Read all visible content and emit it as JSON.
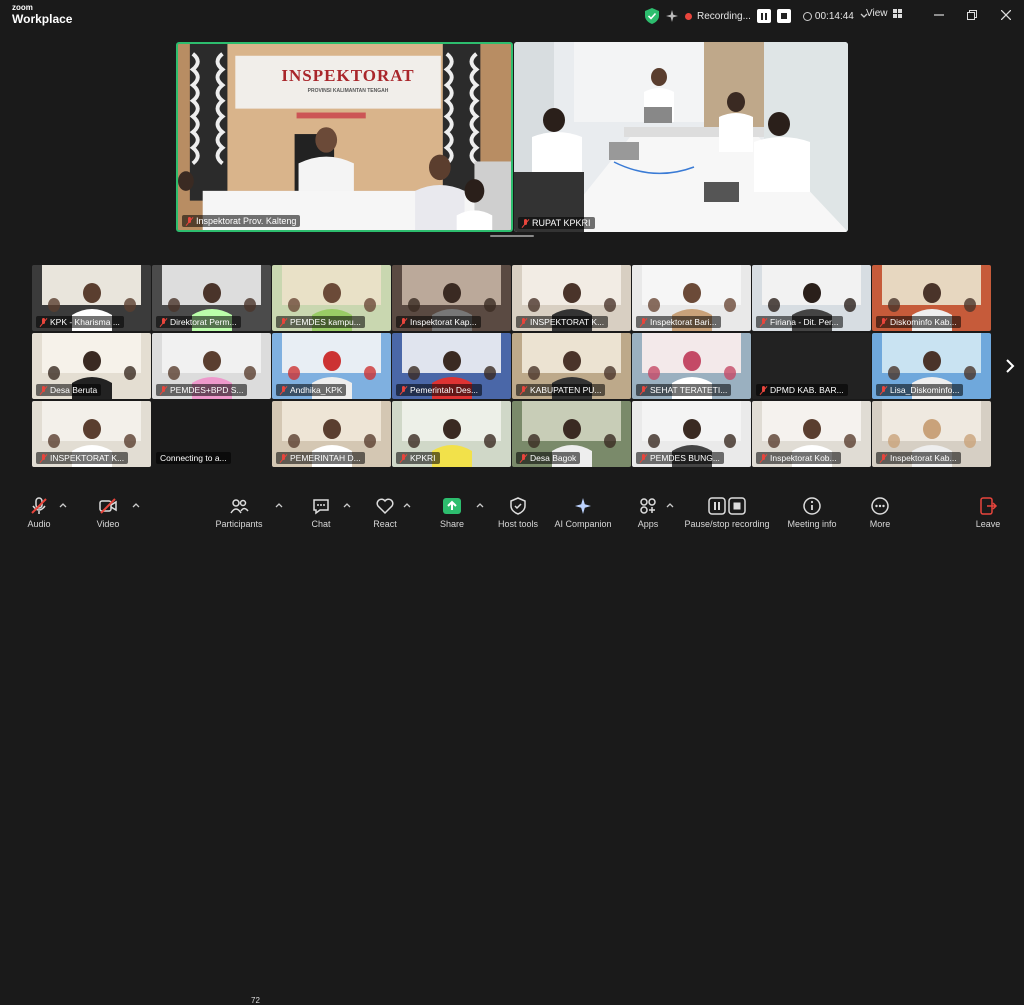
{
  "app": {
    "logo_line1": "zoom",
    "logo_line2": "Workplace"
  },
  "titlebar": {
    "recording_label": "Recording...",
    "timer": "00:14:44",
    "view_label": "View"
  },
  "main_videos": [
    {
      "name": "Inspektorat Prov. Kalteng",
      "banner_title": "INSPEKTORAT",
      "banner_sub": "PROVINSI KALIMANTAN TENGAH",
      "active": true
    },
    {
      "name": "RUPAT KPKRI",
      "active": false
    }
  ],
  "gallery": [
    {
      "name": "KPK - Kharisma ..."
    },
    {
      "name": "Direktorat Perm..."
    },
    {
      "name": "PEMDES kampu..."
    },
    {
      "name": "Inspektorat Kap..."
    },
    {
      "name": "INSPEKTORAT K..."
    },
    {
      "name": "Inspektorat Bari..."
    },
    {
      "name": "Firiana - Dit. Per..."
    },
    {
      "name": "Diskominfo Kab..."
    },
    {
      "name": "Desa Beruta"
    },
    {
      "name": "PEMDES+BPD S..."
    },
    {
      "name": "Andhika_KPK"
    },
    {
      "name": "Pemerintah Des..."
    },
    {
      "name": "KABUPATEN PU..."
    },
    {
      "name": "SEHAT TERATETI..."
    },
    {
      "name": "DPMD KAB. BAR..."
    },
    {
      "name": "Lisa_Diskominfo..."
    },
    {
      "name": "INSPEKTORAT K..."
    },
    {
      "name": "Connecting to a..."
    },
    {
      "name": "PEMERINTAH D..."
    },
    {
      "name": "KPKRI"
    },
    {
      "name": "Desa Bagok"
    },
    {
      "name": "PEMDES BUNG..."
    },
    {
      "name": "Inspektorat Kob..."
    },
    {
      "name": "Inspektorat Kab..."
    }
  ],
  "toolbar": {
    "audio": "Audio",
    "video": "Video",
    "participants": "Participants",
    "participants_count": "72",
    "chat": "Chat",
    "react": "React",
    "share": "Share",
    "host_tools": "Host tools",
    "ai_companion": "AI Companion",
    "apps": "Apps",
    "pause_stop": "Pause/stop recording",
    "meeting_info": "Meeting info",
    "more": "More",
    "leave": "Leave"
  },
  "colors": {
    "accent_green": "#2dbd6e",
    "recording_red": "#e8453c",
    "share_green": "#2dbd6e",
    "background": "#1a1a1a"
  }
}
